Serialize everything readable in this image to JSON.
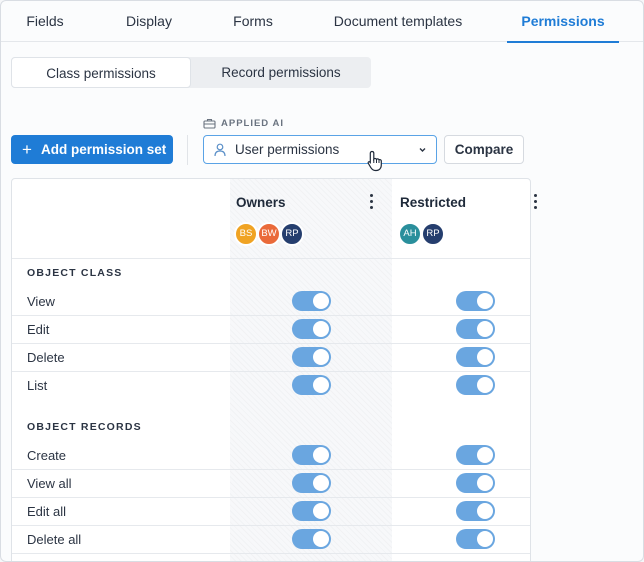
{
  "tabs": [
    {
      "label": "Fields"
    },
    {
      "label": "Display"
    },
    {
      "label": "Forms"
    },
    {
      "label": "Document templates"
    },
    {
      "label": "Permissions",
      "active": true
    }
  ],
  "segmented": [
    {
      "label": "Class permissions",
      "active": true
    },
    {
      "label": "Record permissions"
    }
  ],
  "toolbar": {
    "add_label": "Add permission set",
    "applied_label": "APPLIED AI",
    "select_value": "User permissions",
    "compare_label": "Compare"
  },
  "columns": [
    {
      "title": "Owners",
      "avatars": [
        {
          "initials": "BS",
          "color": "#f0a323"
        },
        {
          "initials": "BW",
          "color": "#ea6a3a"
        },
        {
          "initials": "RP",
          "color": "#253e6e"
        }
      ]
    },
    {
      "title": "Restricted",
      "avatars": [
        {
          "initials": "AH",
          "color": "#2a8f9c"
        },
        {
          "initials": "RP",
          "color": "#253e6e"
        }
      ]
    }
  ],
  "sections": [
    {
      "title": "OBJECT CLASS",
      "rows": [
        {
          "label": "View",
          "owners": true,
          "restricted": true
        },
        {
          "label": "Edit",
          "owners": true,
          "restricted": true
        },
        {
          "label": "Delete",
          "owners": true,
          "restricted": true
        },
        {
          "label": "List",
          "owners": true,
          "restricted": true
        }
      ]
    },
    {
      "title": "OBJECT RECORDS",
      "rows": [
        {
          "label": "Create",
          "owners": true,
          "restricted": true
        },
        {
          "label": "View all",
          "owners": true,
          "restricted": true
        },
        {
          "label": "Edit all",
          "owners": true,
          "restricted": true
        },
        {
          "label": "Delete all",
          "owners": true,
          "restricted": true
        }
      ]
    }
  ],
  "colors": {
    "accent": "#1f7cd6",
    "toggle_on": "#6aa6e0"
  }
}
